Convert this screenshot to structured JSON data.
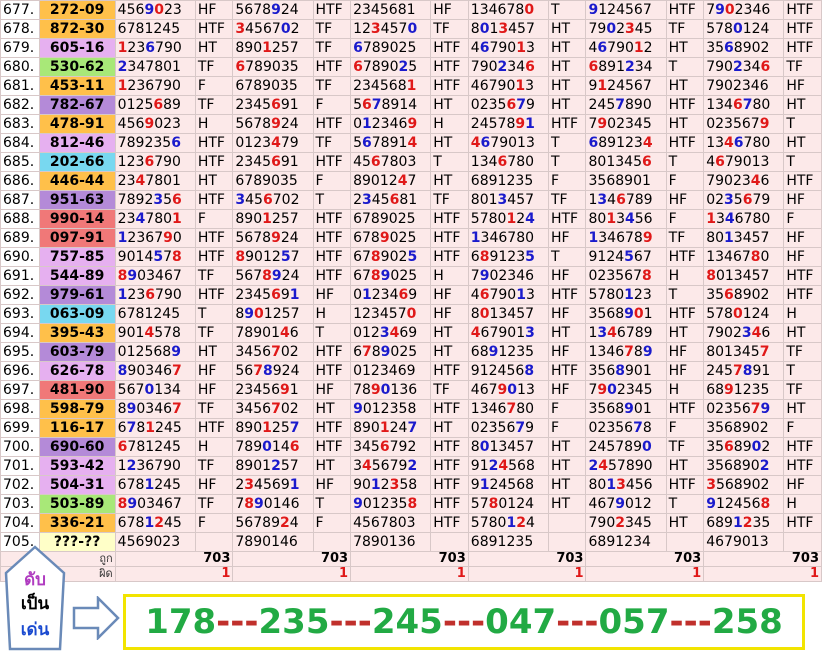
{
  "rows": [
    {
      "n": "677.",
      "code": "272-09",
      "bg": "#ffc04a",
      "c": [
        [
          "4569023",
          "HF"
        ],
        [
          "5678924",
          "HTF"
        ],
        [
          "2345681",
          "HF"
        ],
        [
          "1346780",
          "T"
        ],
        [
          "9124567",
          "HTF"
        ],
        [
          "7902346",
          "HTF"
        ]
      ]
    },
    {
      "n": "678.",
      "code": "872-30",
      "bg": "#ffc04a",
      "c": [
        [
          "6781245",
          "HTF"
        ],
        [
          "3456702",
          "TF"
        ],
        [
          "1234570",
          "TF"
        ],
        [
          "8013457",
          "HT"
        ],
        [
          "7902345",
          "TF"
        ],
        [
          "5780124",
          "HTF"
        ]
      ]
    },
    {
      "n": "679.",
      "code": "605-16",
      "bg": "#e6b0f0",
      "c": [
        [
          "1236790",
          "HT"
        ],
        [
          "8901257",
          "TF"
        ],
        [
          "6789025",
          "HTF"
        ],
        [
          "4679013",
          "HT"
        ],
        [
          "4679012",
          "HT"
        ],
        [
          "3568902",
          "HTF"
        ]
      ]
    },
    {
      "n": "680.",
      "code": "530-62",
      "bg": "#a8e878",
      "c": [
        [
          "2347801",
          "TF"
        ],
        [
          "6789035",
          "HTF"
        ],
        [
          "6789025",
          "HTF"
        ],
        [
          "7902346",
          "HT"
        ],
        [
          "6891234",
          "T"
        ],
        [
          "7902346",
          "TF"
        ]
      ]
    },
    {
      "n": "681.",
      "code": "453-11",
      "bg": "#ffc04a",
      "c": [
        [
          "1236790",
          "F"
        ],
        [
          "6789035",
          "TF"
        ],
        [
          "2345681",
          "HTF"
        ],
        [
          "4679013",
          "HT"
        ],
        [
          "9124567",
          "HT"
        ],
        [
          "7902346",
          "HF"
        ]
      ]
    },
    {
      "n": "682.",
      "code": "782-67",
      "bg": "#b48ad8",
      "c": [
        [
          "0125689",
          "TF"
        ],
        [
          "2345691",
          "F"
        ],
        [
          "5678914",
          "HT"
        ],
        [
          "0235679",
          "HT"
        ],
        [
          "2457890",
          "HTF"
        ],
        [
          "1346780",
          "HT"
        ]
      ]
    },
    {
      "n": "683.",
      "code": "478-91",
      "bg": "#ffc04a",
      "c": [
        [
          "4569023",
          "H"
        ],
        [
          "5678924",
          "HTF"
        ],
        [
          "0123469",
          "H"
        ],
        [
          "2457891",
          "HTF"
        ],
        [
          "7902345",
          "HT"
        ],
        [
          "0235679",
          "T"
        ]
      ]
    },
    {
      "n": "684.",
      "code": "812-46",
      "bg": "#e6b0f0",
      "c": [
        [
          "7892356",
          "HTF"
        ],
        [
          "0123479",
          "TF"
        ],
        [
          "5678914",
          "HT"
        ],
        [
          "4679013",
          "T"
        ],
        [
          "6891234",
          "HTF"
        ],
        [
          "1346780",
          "HT"
        ]
      ]
    },
    {
      "n": "685.",
      "code": "202-66",
      "bg": "#78d8f0",
      "c": [
        [
          "1236790",
          "HTF"
        ],
        [
          "2345691",
          "HTF"
        ],
        [
          "4567803",
          "T"
        ],
        [
          "1346780",
          "T"
        ],
        [
          "8013456",
          "T"
        ],
        [
          "4679013",
          "T"
        ]
      ]
    },
    {
      "n": "686.",
      "code": "446-44",
      "bg": "#ffc04a",
      "c": [
        [
          "2347801",
          "HT"
        ],
        [
          "6789035",
          "F"
        ],
        [
          "8901247",
          "HT"
        ],
        [
          "6891235",
          "F"
        ],
        [
          "3568901",
          "F"
        ],
        [
          "7902346",
          "HTF"
        ]
      ]
    },
    {
      "n": "687.",
      "code": "951-63",
      "bg": "#b48ad8",
      "c": [
        [
          "7892356",
          "HTF"
        ],
        [
          "3456702",
          "T"
        ],
        [
          "2345681",
          "TF"
        ],
        [
          "8013457",
          "TF"
        ],
        [
          "1346789",
          "HF"
        ],
        [
          "0235679",
          "HF"
        ]
      ]
    },
    {
      "n": "688.",
      "code": "990-14",
      "bg": "#f07878",
      "c": [
        [
          "2347801",
          "F"
        ],
        [
          "8901257",
          "HTF"
        ],
        [
          "6789025",
          "HTF"
        ],
        [
          "5780124",
          "HTF"
        ],
        [
          "8013456",
          "F"
        ],
        [
          "1346780",
          "F"
        ]
      ]
    },
    {
      "n": "689.",
      "code": "097-91",
      "bg": "#f07878",
      "c": [
        [
          "1236790",
          "HTF"
        ],
        [
          "5678924",
          "HTF"
        ],
        [
          "6789025",
          "HTF"
        ],
        [
          "1346780",
          "HF"
        ],
        [
          "1346789",
          "TF"
        ],
        [
          "8013457",
          "HF"
        ]
      ]
    },
    {
      "n": "690.",
      "code": "757-85",
      "bg": "#e6b0f0",
      "c": [
        [
          "9014578",
          "HTF"
        ],
        [
          "8901257",
          "HTF"
        ],
        [
          "6789025",
          "HTF"
        ],
        [
          "6891235",
          "T"
        ],
        [
          "9124567",
          "HTF"
        ],
        [
          "1346780",
          "HF"
        ]
      ]
    },
    {
      "n": "691.",
      "code": "544-89",
      "bg": "#e6b0f0",
      "c": [
        [
          "8903467",
          "TF"
        ],
        [
          "5678924",
          "HTF"
        ],
        [
          "6789025",
          "H"
        ],
        [
          "7902346",
          "HF"
        ],
        [
          "0235678",
          "H"
        ],
        [
          "8013457",
          "HTF"
        ]
      ]
    },
    {
      "n": "692.",
      "code": "979-61",
      "bg": "#b48ad8",
      "c": [
        [
          "1236790",
          "HTF"
        ],
        [
          "2345691",
          "HF"
        ],
        [
          "0123469",
          "HF"
        ],
        [
          "4679013",
          "HTF"
        ],
        [
          "5780123",
          "T"
        ],
        [
          "3568902",
          "HTF"
        ]
      ]
    },
    {
      "n": "693.",
      "code": "063-09",
      "bg": "#78d8f0",
      "c": [
        [
          "6781245",
          "T"
        ],
        [
          "8901257",
          "H"
        ],
        [
          "1234570",
          "HF"
        ],
        [
          "8013457",
          "HF"
        ],
        [
          "3568901",
          "HTF"
        ],
        [
          "5780124",
          "H"
        ]
      ]
    },
    {
      "n": "694.",
      "code": "395-43",
      "bg": "#ffc04a",
      "c": [
        [
          "9014578",
          "TF"
        ],
        [
          "7890146",
          "T"
        ],
        [
          "0123469",
          "HT"
        ],
        [
          "4679013",
          "HT"
        ],
        [
          "1346789",
          "HT"
        ],
        [
          "7902346",
          "HT"
        ]
      ]
    },
    {
      "n": "695.",
      "code": "603-79",
      "bg": "#b48ad8",
      "c": [
        [
          "0125689",
          "HT"
        ],
        [
          "3456702",
          "HTF"
        ],
        [
          "6789025",
          "HT"
        ],
        [
          "6891235",
          "HF"
        ],
        [
          "1346789",
          "HF"
        ],
        [
          "8013457",
          "TF"
        ]
      ]
    },
    {
      "n": "696.",
      "code": "626-78",
      "bg": "#e6b0f0",
      "c": [
        [
          "8903467",
          "HF"
        ],
        [
          "5678924",
          "HTF"
        ],
        [
          "0123469",
          "HTF"
        ],
        [
          "9124568",
          "HTF"
        ],
        [
          "3568901",
          "HF"
        ],
        [
          "2457891",
          "T"
        ]
      ]
    },
    {
      "n": "697.",
      "code": "481-90",
      "bg": "#f07878",
      "c": [
        [
          "5670134",
          "HF"
        ],
        [
          "2345691",
          "HF"
        ],
        [
          "7890136",
          "TF"
        ],
        [
          "4679013",
          "HF"
        ],
        [
          "7902345",
          "H"
        ],
        [
          "6891235",
          "TF"
        ]
      ]
    },
    {
      "n": "698.",
      "code": "598-79",
      "bg": "#ffc04a",
      "c": [
        [
          "8903467",
          "TF"
        ],
        [
          "3456702",
          "HT"
        ],
        [
          "9012358",
          "HTF"
        ],
        [
          "1346780",
          "F"
        ],
        [
          "3568901",
          "HTF"
        ],
        [
          "0235679",
          "HT"
        ]
      ]
    },
    {
      "n": "699.",
      "code": "116-17",
      "bg": "#ffc04a",
      "c": [
        [
          "6781245",
          "HTF"
        ],
        [
          "8901257",
          "HTF"
        ],
        [
          "8901247",
          "HT"
        ],
        [
          "0235679",
          "F"
        ],
        [
          "0235678",
          "F"
        ],
        [
          "3568902",
          "F"
        ]
      ]
    },
    {
      "n": "700.",
      "code": "690-60",
      "bg": "#b48ad8",
      "c": [
        [
          "6781245",
          "H"
        ],
        [
          "7890146",
          "HTF"
        ],
        [
          "3456792",
          "HTF"
        ],
        [
          "8013457",
          "HT"
        ],
        [
          "2457890",
          "TF"
        ],
        [
          "3568902",
          "HTF"
        ]
      ]
    },
    {
      "n": "701.",
      "code": "593-42",
      "bg": "#e6b0f0",
      "c": [
        [
          "1236790",
          "TF"
        ],
        [
          "8901257",
          "HT"
        ],
        [
          "3456792",
          "HTF"
        ],
        [
          "9124568",
          "HT"
        ],
        [
          "2457890",
          "HT"
        ],
        [
          "3568902",
          "HTF"
        ]
      ]
    },
    {
      "n": "702.",
      "code": "504-31",
      "bg": "#e6b0f0",
      "c": [
        [
          "6781245",
          "HF"
        ],
        [
          "2345691",
          "HF"
        ],
        [
          "9012358",
          "HTF"
        ],
        [
          "9124568",
          "HT"
        ],
        [
          "8013456",
          "HTF"
        ],
        [
          "3568902",
          "HF"
        ]
      ]
    },
    {
      "n": "703.",
      "code": "503-89",
      "bg": "#a8e878",
      "c": [
        [
          "8903467",
          "TF"
        ],
        [
          "7890146",
          "T"
        ],
        [
          "9012358",
          "HTF"
        ],
        [
          "5780124",
          "HT"
        ],
        [
          "4679012",
          "T"
        ],
        [
          "9124568",
          "H"
        ]
      ]
    },
    {
      "n": "704.",
      "code": "336-21",
      "bg": "#ffc04a",
      "c": [
        [
          "6781245",
          "F"
        ],
        [
          "5678924",
          "F"
        ],
        [
          "4567803",
          "HTF"
        ],
        [
          "5780124",
          ""
        ],
        [
          "7902345",
          "HT"
        ],
        [
          "6891235",
          "HTF"
        ]
      ]
    },
    {
      "n": "705.",
      "code": "???-??",
      "bg": "#ffffc8",
      "c": [
        [
          "4569023",
          ""
        ],
        [
          "7890146",
          ""
        ],
        [
          "7890136",
          ""
        ],
        [
          "6891235",
          ""
        ],
        [
          "6891234",
          ""
        ],
        [
          "4679013",
          ""
        ]
      ]
    }
  ],
  "totals": {
    "label_correct": "ถูก",
    "label_wrong": "ผิด",
    "correct": [
      "703",
      "703",
      "703",
      "703",
      "703",
      "703"
    ],
    "wrong": [
      "1",
      "1",
      "1",
      "1",
      "1",
      "1"
    ]
  },
  "pentagon": {
    "line1": "ดับ",
    "line2": "เป็น",
    "line3": "เด่น"
  },
  "banner": {
    "groups": [
      "178",
      "235",
      "245",
      "047",
      "057",
      "258"
    ],
    "separator": "---"
  },
  "colors": {
    "red_digit": "#e01818",
    "blue_digit": "#1a1acc",
    "banner_green": "#22aa44",
    "banner_border": "#f2e400",
    "cell_bg": "#fce9e9"
  }
}
